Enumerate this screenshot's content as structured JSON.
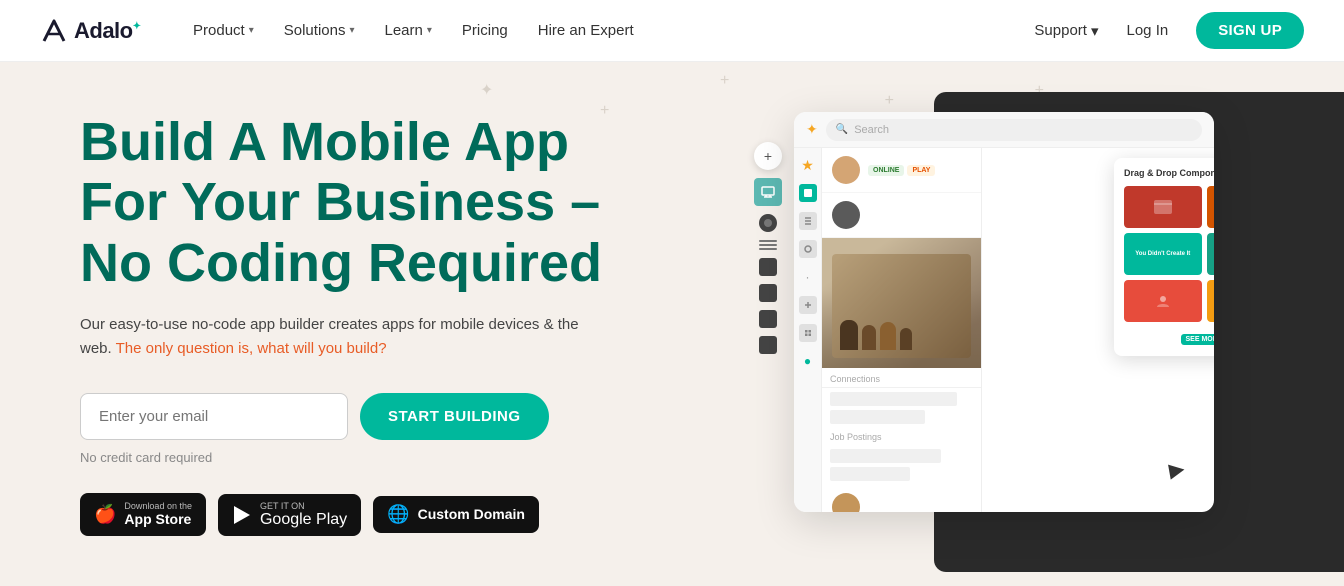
{
  "brand": {
    "name": "Adalo",
    "logo_symbol": "A"
  },
  "nav": {
    "links": [
      {
        "label": "Product",
        "has_dropdown": true,
        "id": "product"
      },
      {
        "label": "Solutions",
        "has_dropdown": true,
        "id": "solutions"
      },
      {
        "label": "Learn",
        "has_dropdown": true,
        "id": "learn"
      },
      {
        "label": "Pricing",
        "has_dropdown": false,
        "id": "pricing"
      },
      {
        "label": "Hire an Expert",
        "has_dropdown": false,
        "id": "hire-expert"
      }
    ],
    "support_label": "Support",
    "login_label": "Log In",
    "signup_label": "SIGN UP"
  },
  "hero": {
    "title": "Build A Mobile App For Your Business – No Coding Required",
    "subtitle_part1": "Our easy-to-use no-code app builder creates apps for mobile devices & the web.",
    "subtitle_highlight": " The only question is, what will you build?",
    "email_placeholder": "Enter your email",
    "cta_label": "START BUILDING",
    "no_credit": "No credit card required",
    "badges": [
      {
        "id": "app-store",
        "icon": "🍎",
        "sub": "Download on the",
        "name": "App Store"
      },
      {
        "id": "google-play",
        "icon": "▶",
        "sub": "GET IT ON",
        "name": "Google Play"
      },
      {
        "id": "custom-domain",
        "icon": "🌐",
        "sub": "",
        "name": "Custom Domain"
      }
    ]
  },
  "editor_ui": {
    "search_placeholder": "Search",
    "drag_drop_label": "Drag & Drop Components",
    "connections_label": "Connections",
    "job_postings_label": "Job Postings",
    "see_more_label": "SEE MORE",
    "status_online": "ONLINE",
    "status_play": "PLAY",
    "see_more_badge": "SEE MORE"
  },
  "colors": {
    "primary": "#00b89c",
    "hero_bg": "#f5f0eb",
    "title_color": "#006b5a",
    "highlight_color": "#e85c26",
    "dark_panel": "#2a2a2a",
    "signup_bg": "#00b89c"
  }
}
